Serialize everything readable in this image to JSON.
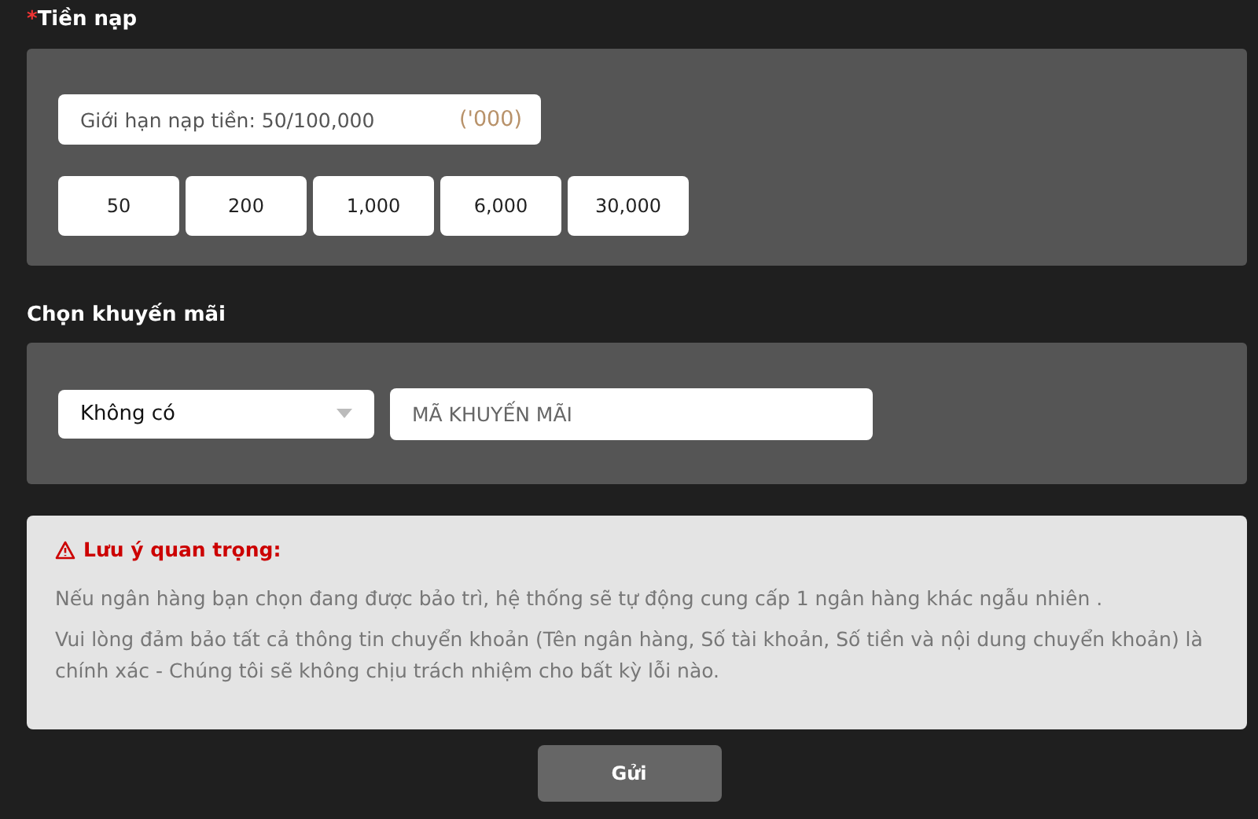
{
  "amount_section": {
    "required_mark": "*",
    "label": "Tiền nạp",
    "limit_field": {
      "placeholder": "Giới hạn nạp tiền: 50/100,000",
      "unit": "('000)"
    },
    "quick_amounts": [
      "50",
      "200",
      "1,000",
      "6,000",
      "30,000"
    ]
  },
  "promo_section": {
    "label": "Chọn khuyến mãi",
    "select": {
      "value": "Không có"
    },
    "code_field": {
      "placeholder": "MÃ KHUYẾN MÃI"
    }
  },
  "notice": {
    "title": "Lưu ý quan trọng:",
    "paragraphs": [
      "Nếu ngân hàng bạn chọn đang được bảo trì, hệ thống sẽ tự động cung cấp 1 ngân hàng khác ngẫu nhiên .",
      "Vui lòng đảm bảo tất cả thông tin chuyển khoản (Tên ngân hàng, Số tài khoản, Số tiền và nội dung chuyển khoản) là chính xác - Chúng tôi sẽ không chịu trách nhiệm cho bất kỳ lỗi nào."
    ]
  },
  "submit_button": "Gửi"
}
